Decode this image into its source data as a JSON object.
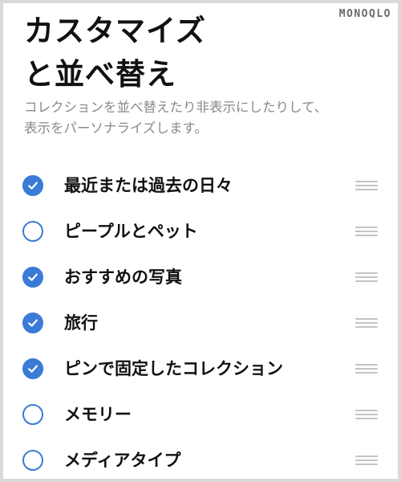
{
  "watermark": "MONOQLO",
  "header": {
    "title_line1": "カスタマイズ",
    "title_line2": "と並べ替え",
    "description_line1": "コレクションを並べ替えたり非表示にしたりして、",
    "description_line2": "表示をパーソナライズします。"
  },
  "collections": [
    {
      "label": "最近または過去の日々",
      "checked": true
    },
    {
      "label": "ピープルとペット",
      "checked": false
    },
    {
      "label": "おすすめの写真",
      "checked": true
    },
    {
      "label": "旅行",
      "checked": true
    },
    {
      "label": "ピンで固定したコレクション",
      "checked": true
    },
    {
      "label": "メモリー",
      "checked": false
    },
    {
      "label": "メディアタイプ",
      "checked": false
    }
  ],
  "icons": {
    "checkbox": "checkmark-circle-icon",
    "reorder": "reorder-handle-icon"
  },
  "colors": {
    "accent": "#3a7bd5",
    "secondary_text": "#8a8a8e",
    "handle": "#c4c4c6"
  }
}
